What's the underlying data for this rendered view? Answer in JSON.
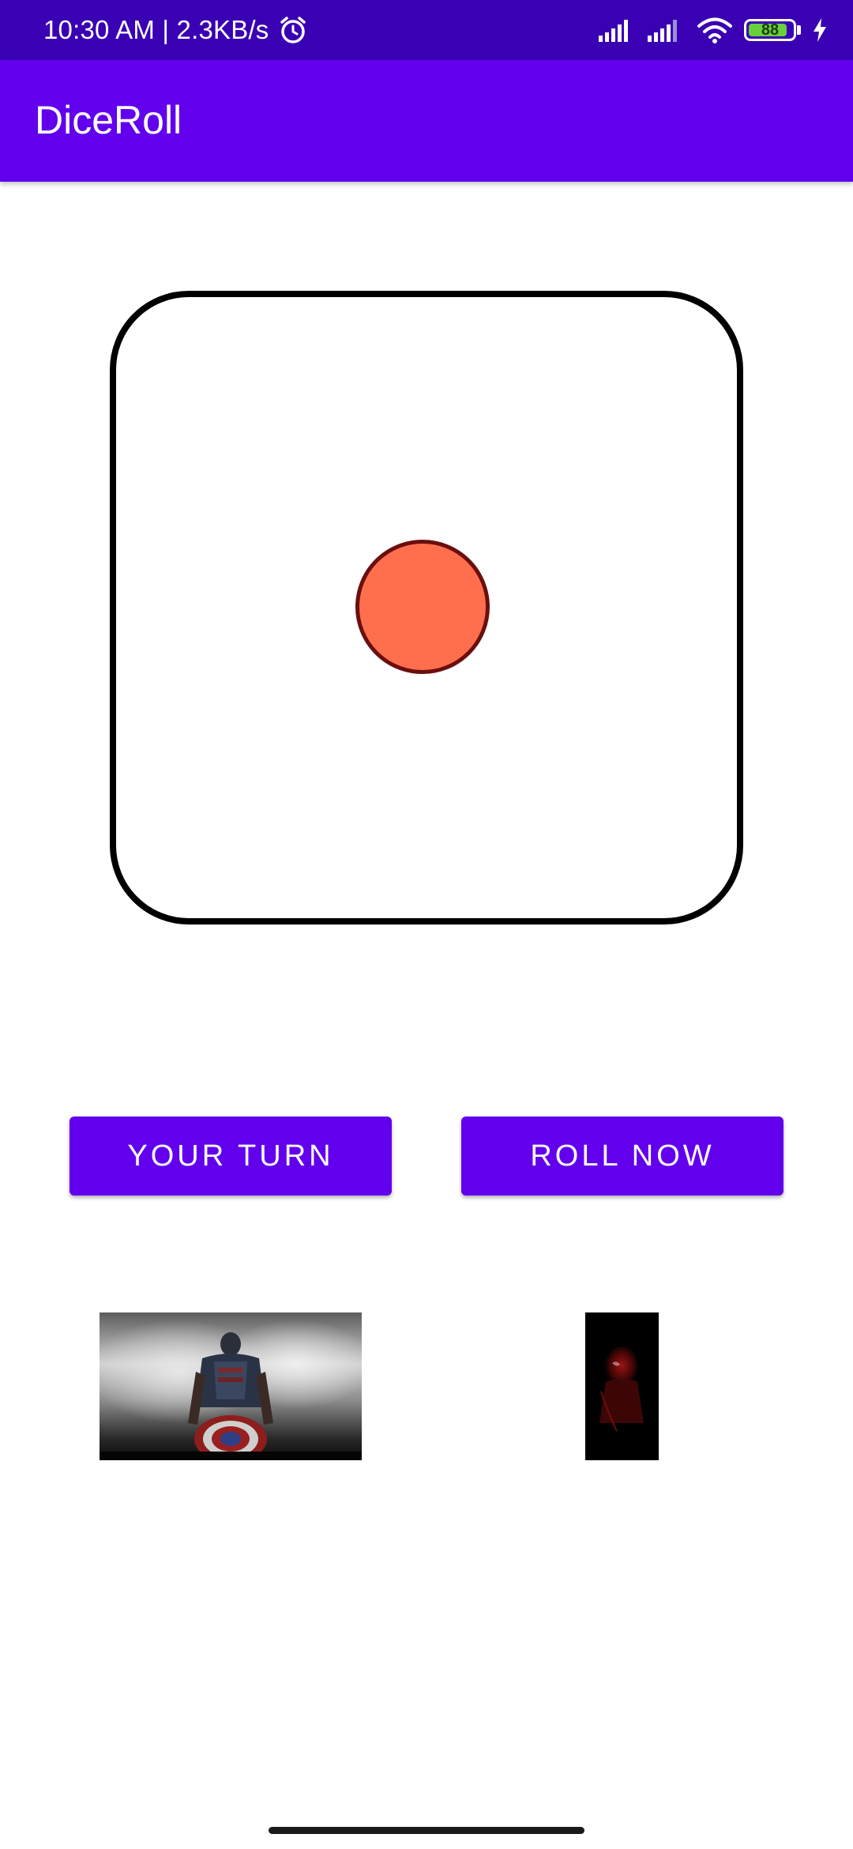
{
  "status_bar": {
    "time_text": "10:30 AM | 2.3KB/s",
    "battery_level": "88",
    "icons": [
      "alarm-icon",
      "signal-icon",
      "signal-icon",
      "wifi-icon",
      "battery-icon",
      "charging-icon"
    ]
  },
  "app_bar": {
    "title": "DiceRoll",
    "color": "#6200ee"
  },
  "dice": {
    "value": 1,
    "pip_color": "#ff6f4d",
    "pip_border_color": "#6b0e0e"
  },
  "buttons": {
    "your_turn_label": "YOUR TURN",
    "roll_now_label": "ROLL NOW"
  },
  "images": {
    "left_icon": "captain-america-image",
    "right_icon": "spider-man-image"
  },
  "colors": {
    "status_bar": "#3a00b3",
    "primary": "#6200ee",
    "battery_fill": "#67d13c"
  }
}
